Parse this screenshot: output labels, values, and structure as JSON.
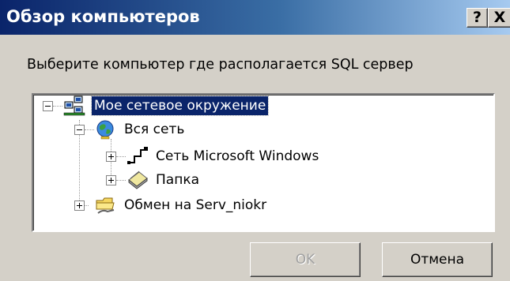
{
  "window": {
    "title": "Обзор компьютеров",
    "help_glyph": "?",
    "close_glyph": "X"
  },
  "prompt": "Выберите компьютер где располагается SQL сервер",
  "tree": {
    "nodes": [
      {
        "label": "Мое сетевое окружение",
        "icon": "network-neighborhood-icon",
        "expander": "minus",
        "selected": true,
        "level": 0
      },
      {
        "label": "Вся сеть",
        "icon": "globe-icon",
        "expander": "minus",
        "selected": false,
        "level": 1
      },
      {
        "label": "Сеть Microsoft Windows",
        "icon": "network-provider-icon",
        "expander": "plus",
        "selected": false,
        "level": 2
      },
      {
        "label": "Папка",
        "icon": "folder-share-icon",
        "expander": "plus",
        "selected": false,
        "level": 2
      },
      {
        "label": "Обмен на Serv_niokr",
        "icon": "shared-folder-icon",
        "expander": "plus",
        "selected": false,
        "level": 1
      }
    ]
  },
  "buttons": {
    "ok_label": "OK",
    "cancel_label": "Отмена",
    "ok_enabled": false
  },
  "colors": {
    "title_start": "#0a246a",
    "title_end": "#a6caf0",
    "face": "#d4d0c8",
    "selection": "#0a246a"
  }
}
